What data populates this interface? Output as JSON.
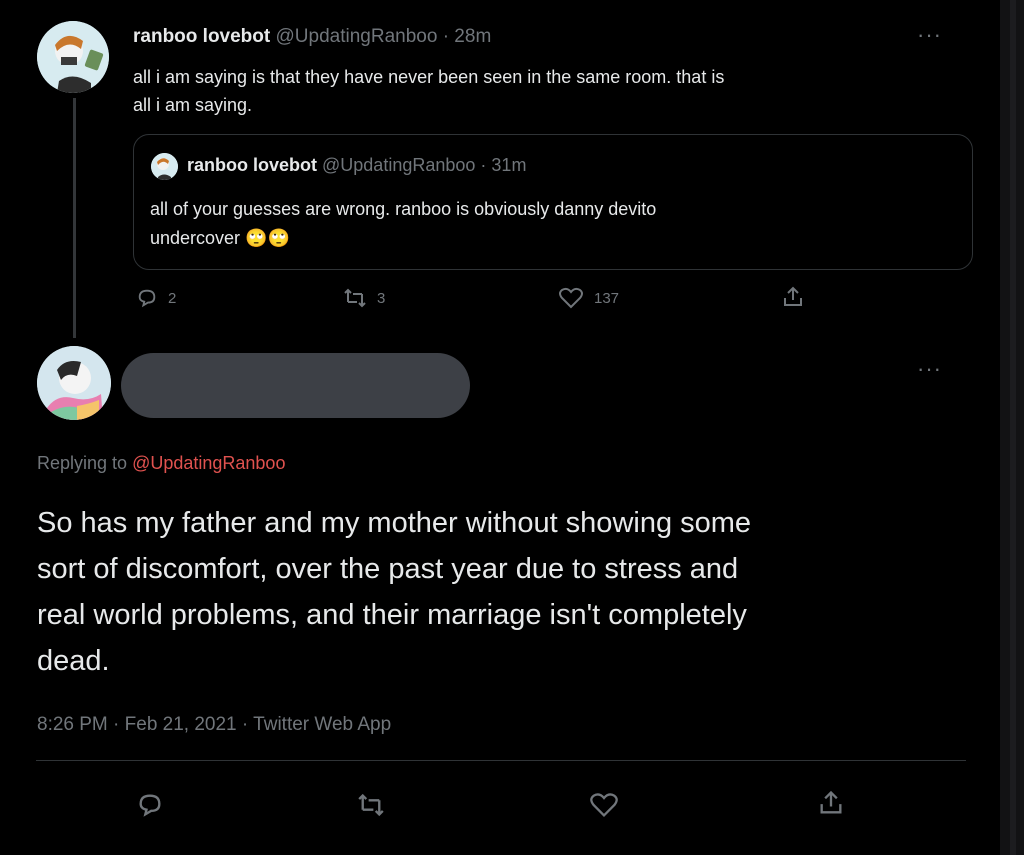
{
  "parent_tweet": {
    "display_name": "ranboo lovebot",
    "handle": "@UpdatingRanboo",
    "time": "· 28m",
    "text_line1": "all i am saying is that they have never been seen in the same room. that is",
    "text_line2": "all i am saying.",
    "quoted": {
      "display_name": "ranboo lovebot",
      "handle": "@UpdatingRanboo",
      "time": "· 31m",
      "text_line1": "all of your guesses are wrong. ranboo is obviously danny devito",
      "text_line2": "undercover",
      "emoji": [
        "🙄",
        "🙄"
      ]
    },
    "stats": {
      "replies": "2",
      "retweets": "3",
      "likes": "137"
    }
  },
  "reply_tweet": {
    "replying_prefix": "Replying to",
    "replying_handle": "@UpdatingRanboo",
    "text_line1": "So has my father and my mother without showing some",
    "text_line2": "sort of discomfort, over the past year due to stress and",
    "text_line3": "real world problems, and their marriage isn't completely",
    "text_line4": "dead.",
    "meta": "8:26 PM · Feb 21, 2021 · Twitter Web App"
  },
  "more_label": "···",
  "colors": {
    "background": "#000000",
    "text": "#e7e9ea",
    "muted": "#71767b",
    "link": "#e0524f",
    "border": "#2f3336"
  }
}
